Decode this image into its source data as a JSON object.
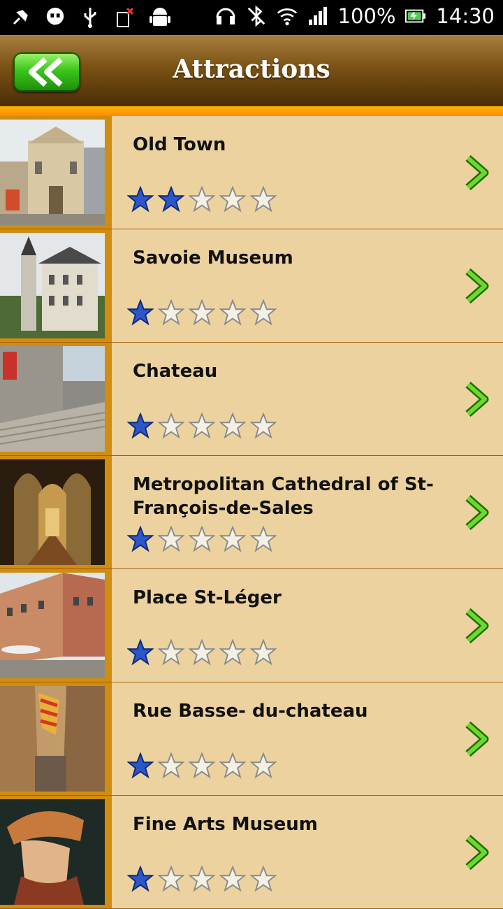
{
  "status_bar": {
    "battery": "100%",
    "time": "14:30",
    "left_icons": [
      "pin-icon",
      "hangouts-icon",
      "usb-icon",
      "sim-icon",
      "android-icon"
    ],
    "right_icons": [
      "headset-icon",
      "bluetooth-off-icon",
      "wifi-icon",
      "signal-icon",
      "battery-icon"
    ]
  },
  "header": {
    "title": "Attractions",
    "back_icon": "double-chevron-left-icon"
  },
  "items": [
    {
      "name": "Old Town",
      "rating": 2,
      "max_rating": 5,
      "photo": "old-town-photo"
    },
    {
      "name": "Savoie Museum",
      "rating": 1,
      "max_rating": 5,
      "photo": "savoie-museum-photo"
    },
    {
      "name": "Chateau",
      "rating": 1,
      "max_rating": 5,
      "photo": "chateau-photo"
    },
    {
      "name": "Metropolitan Cathedral of St-François-de-Sales",
      "rating": 1,
      "max_rating": 5,
      "photo": "cathedral-photo"
    },
    {
      "name": "Place St-Léger",
      "rating": 1,
      "max_rating": 5,
      "photo": "place-st-leger-photo"
    },
    {
      "name": "Rue Basse- du-chateau",
      "rating": 1,
      "max_rating": 5,
      "photo": "rue-basse-photo"
    },
    {
      "name": "Fine Arts Museum",
      "rating": 1,
      "max_rating": 5,
      "photo": "fine-arts-museum-photo"
    }
  ],
  "colors": {
    "row_bg": "#ecd29e",
    "accent_strip": "#ff9a00",
    "star_filled": "#2d57c8",
    "chevron": "#3fae12"
  }
}
